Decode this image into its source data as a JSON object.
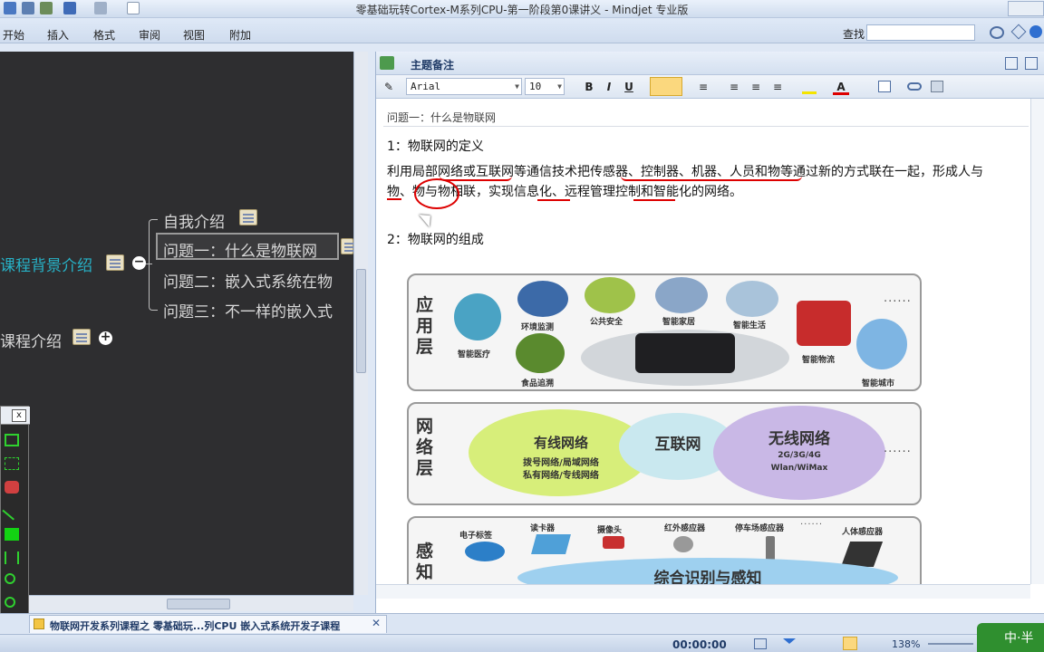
{
  "window": {
    "title": "零基础玩转Cortex-M系列CPU-第一阶段第0课讲义 - Mindjet 专业版"
  },
  "ribbon": {
    "tabs": [
      "开始",
      "插入",
      "格式",
      "审阅",
      "视图",
      "附加"
    ],
    "find_label": "查找"
  },
  "map": {
    "central_topic": "课程背景介绍",
    "subtopics": [
      "自我介绍",
      "问题一：什么是物联网",
      "问题二：嵌入式系统在物",
      "问题三：不一样的嵌入式"
    ],
    "second_topic": "课程介绍",
    "collapse_symbol": "−",
    "expand_symbol": "+"
  },
  "palette": {
    "close": "x"
  },
  "notes": {
    "panel_title": "主题备注",
    "font_name": "Arial",
    "font_size": "10",
    "topic_path": "问题一：什么是物联网",
    "heading1": "1：物联网的定义",
    "definition_line1": "利用局部网络或互联网等通信技术把传感器、控制器、机器、人员和物等通过新的方式联在一起，形成人与",
    "definition_line2": "物、物与物相联，实现信息化、远程管理控制和智能化的网络。",
    "heading2": "2：物联网的组成"
  },
  "diagram": {
    "layers": [
      {
        "name": "应用层"
      },
      {
        "name": "网络层"
      },
      {
        "name": "感知"
      }
    ],
    "application_items": [
      "智能医疗",
      "环境监测",
      "公共安全",
      "智能家居",
      "智能生活",
      "智能物流",
      "智能城市",
      "食品追溯"
    ],
    "network_clouds": [
      {
        "title": "有线网络",
        "sub1": "拨号网络/局域网络",
        "sub2": "私有网络/专线网络"
      },
      {
        "title": "互联网",
        "sub1": "",
        "sub2": ""
      },
      {
        "title": "无线网络",
        "sub1": "2G/3G/4G",
        "sub2": "Wlan/WiMax"
      }
    ],
    "perception_items": [
      "电子标签",
      "读卡器",
      "摄像头",
      "红外感应器",
      "停车场感应器",
      "人体感应器"
    ],
    "perception_title": "综合识别与感知",
    "ellipsis": "······"
  },
  "doc_tab": {
    "label": "物联网开发系列课程之 零基础玩...列CPU 嵌入式系统开发子课程",
    "close": "✕"
  },
  "status": {
    "time": "00:00:00",
    "zoom": "138%"
  },
  "watermark": "中·半"
}
